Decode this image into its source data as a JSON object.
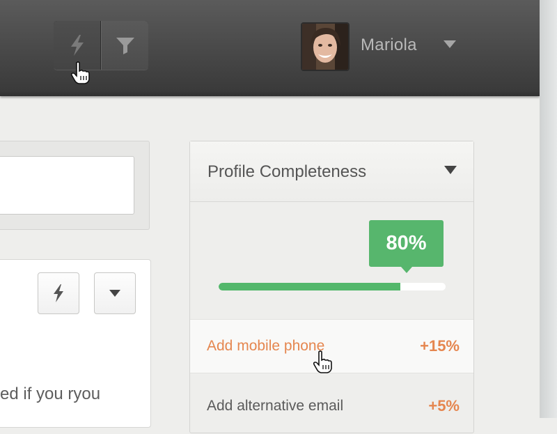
{
  "header": {
    "quick_actions": [
      {
        "icon": "lightning-icon",
        "active": true
      },
      {
        "icon": "filter-icon",
        "active": false
      }
    ],
    "user": {
      "name": "Mariola"
    }
  },
  "main": {
    "card": {
      "text": "ed if you ryou"
    }
  },
  "profile_widget": {
    "title": "Profile Completeness",
    "completion_label": "80%",
    "completion_value": 0.8,
    "tasks": [
      {
        "label": "Add mobile phone",
        "value": "+15%",
        "color": "#e5864f"
      },
      {
        "label": "Add alternative email",
        "value": "+5%",
        "color": "#5a5a5a"
      }
    ]
  },
  "colors": {
    "accent_green": "#57b66d",
    "accent_orange": "#e5864f"
  }
}
